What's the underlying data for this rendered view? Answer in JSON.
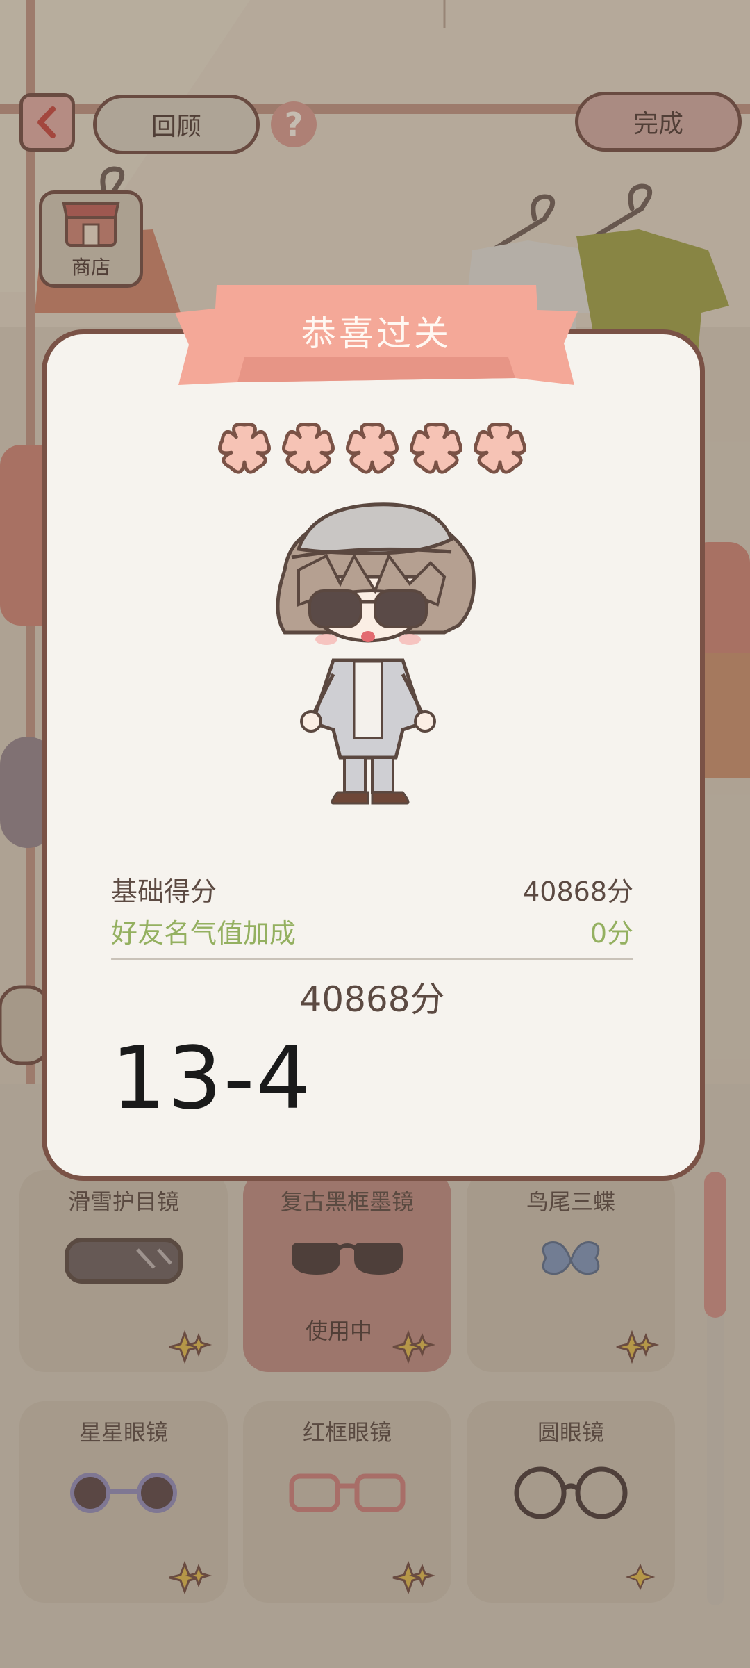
{
  "top_bar": {
    "review_label": "回顾",
    "done_label": "完成",
    "help_symbol": "?",
    "shop_label": "商店"
  },
  "result_dialog": {
    "title": "恭喜过关",
    "stars_filled": 5,
    "stars_total": 5,
    "base_score_label": "基础得分",
    "base_score_value": "40868分",
    "bonus_label": "好友名气值加成",
    "bonus_value": "0分",
    "total_value": "40868分",
    "level_text": "13-4"
  },
  "items": [
    {
      "name": "滑雪护目镜",
      "status": ""
    },
    {
      "name": "复古黑框墨镜",
      "status": "使用中"
    },
    {
      "name": "鸟尾三蝶",
      "status": ""
    },
    {
      "name": "星星眼镜",
      "status": ""
    },
    {
      "name": "红框眼镜",
      "status": ""
    },
    {
      "name": "圆眼镜",
      "status": ""
    }
  ],
  "colors": {
    "accent": "#f4a898",
    "modal_border": "#7a5246",
    "bonus_green": "#94b060",
    "star_fill": "#f6c3b5"
  }
}
